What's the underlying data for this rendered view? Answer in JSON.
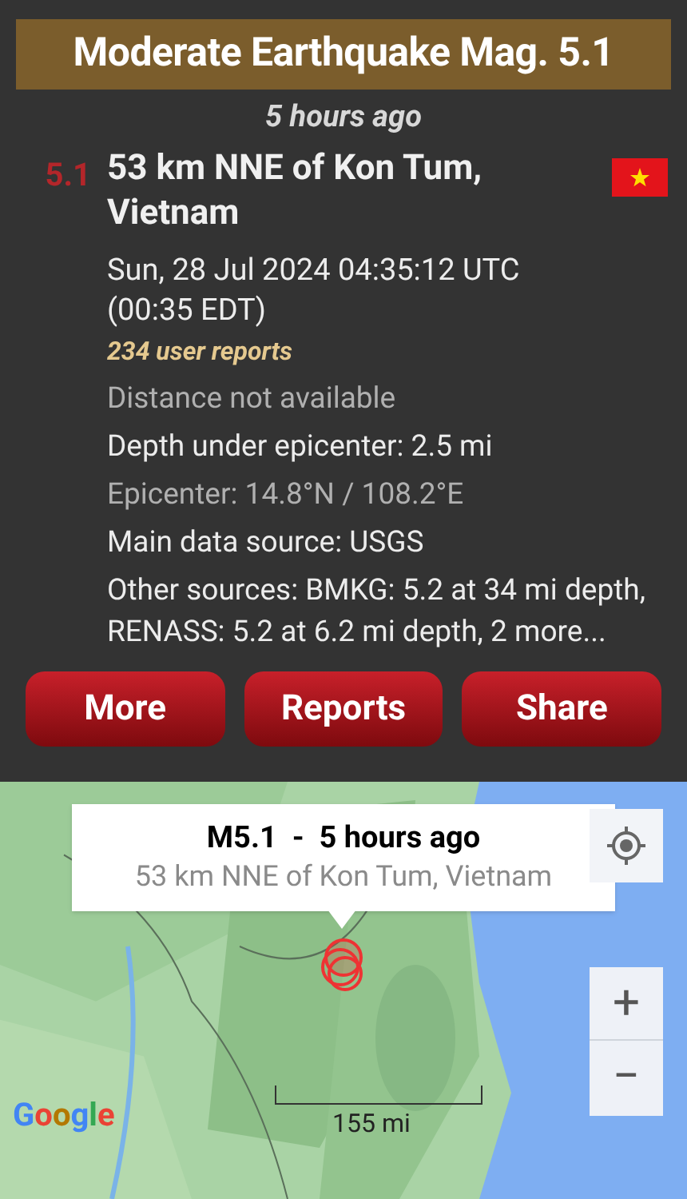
{
  "banner": {
    "title": "Moderate Earthquake Mag. 5.1"
  },
  "time_ago": "5 hours ago",
  "event": {
    "magnitude": "5.1",
    "place": "53 km NNE of Kon Tum, Vietnam",
    "datetime": "Sun, 28 Jul 2024 04:35:12 UTC (00:35 EDT)",
    "user_reports": "234 user reports",
    "details": [
      {
        "kind": "dim",
        "text": "Distance not available"
      },
      {
        "kind": "plain",
        "text": "Depth under epicenter: 2.5 mi"
      },
      {
        "kind": "dim",
        "text": "Epicenter: 14.8°N / 108.2°E"
      },
      {
        "kind": "plain",
        "text": "Main data source: USGS"
      },
      {
        "kind": "tight",
        "text": "Other sources: BMKG: 5.2 at 34 mi depth, RENASS: 5.2 at 6.2 mi depth, 2 more..."
      }
    ]
  },
  "buttons": [
    "More",
    "Reports",
    "Share"
  ],
  "map": {
    "popup": {
      "title": "M5.1  -  5 hours ago",
      "subtitle": "53 km NNE of Kon Tum, Vietnam"
    },
    "zoom_in": "+",
    "zoom_out": "−",
    "scale": "155 mi",
    "attribution": "Google"
  }
}
